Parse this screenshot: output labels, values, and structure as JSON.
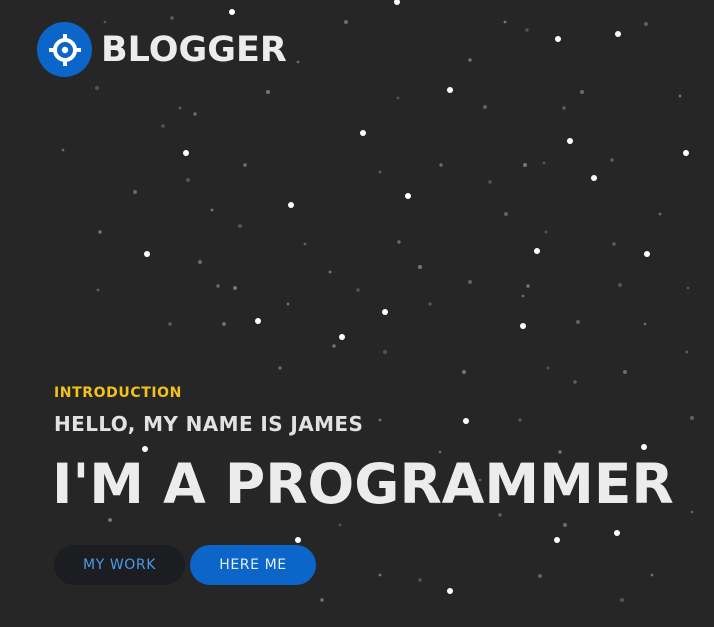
{
  "brand": {
    "name": "BLOGGER",
    "logo_icon": "crosshair-icon",
    "accent_color": "#0c66c9"
  },
  "hero": {
    "label": "INTRODUCTION",
    "label_color": "#f2c21b",
    "greeting": "HELLO, MY NAME IS JAMES",
    "headline": "I'M A PROGRAMMER"
  },
  "actions": {
    "work_label": "MY WORK",
    "hire_label": "HERE ME"
  },
  "background": {
    "color": "#262626",
    "decoration": "starfield"
  }
}
